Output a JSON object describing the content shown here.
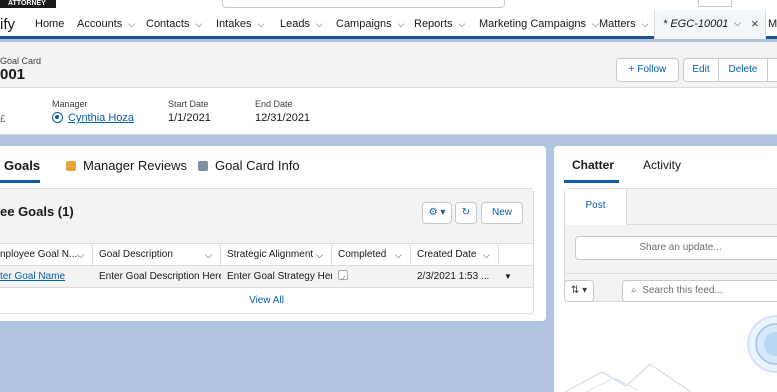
{
  "brand": {
    "tag": "ATTORNEY"
  },
  "app": {
    "name": "ify"
  },
  "nav": {
    "items": [
      {
        "label": "Home",
        "has_menu": false
      },
      {
        "label": "Accounts",
        "has_menu": true
      },
      {
        "label": "Contacts",
        "has_menu": true
      },
      {
        "label": "Intakes",
        "has_menu": true
      },
      {
        "label": "Leads",
        "has_menu": true
      },
      {
        "label": "Campaigns",
        "has_menu": true
      },
      {
        "label": "Reports",
        "has_menu": true
      },
      {
        "label": "Marketing Campaigns",
        "has_menu": true
      },
      {
        "label": "Matters",
        "has_menu": true
      }
    ],
    "active_tab": {
      "label": "* EGC-10001"
    },
    "more_label": "Mo"
  },
  "record": {
    "object_type": "Goal Card",
    "title": "001",
    "buttons": {
      "follow": "+ Follow",
      "edit": "Edit",
      "delete": "Delete"
    }
  },
  "highlights": {
    "left_glyph": "£",
    "manager": {
      "label": "Manager",
      "value": "Cynthia Hoza"
    },
    "start_date": {
      "label": "Start Date",
      "value": "1/1/2021"
    },
    "end_date": {
      "label": "End Date",
      "value": "12/31/2021"
    }
  },
  "tabs": {
    "goals": "Goals",
    "manager_reviews": "Manager Reviews",
    "goal_card_info": "Goal Card Info"
  },
  "related_list": {
    "title": "ee Goals (1)",
    "new_label": "New",
    "columns": [
      "nployee Goal N...",
      "Goal Description",
      "Strategic Alignment",
      "Completed",
      "Created Date"
    ],
    "rows": [
      {
        "goal_name": "ter Goal Name",
        "description": "Enter Goal Description Here",
        "alignment": "Enter Goal Strategy Here",
        "completed": true,
        "created": "2/3/2021 1:53 ..."
      }
    ],
    "view_all": "View All"
  },
  "side": {
    "tabs": {
      "chatter": "Chatter",
      "activity": "Activity"
    },
    "post_tab": "Post",
    "share_placeholder": "Share an update...",
    "search_placeholder": "Search this feed..."
  },
  "colors": {
    "brand_blue": "#0b5cab",
    "nav_border": "#1b5297",
    "page_bg": "#b0c4df"
  }
}
